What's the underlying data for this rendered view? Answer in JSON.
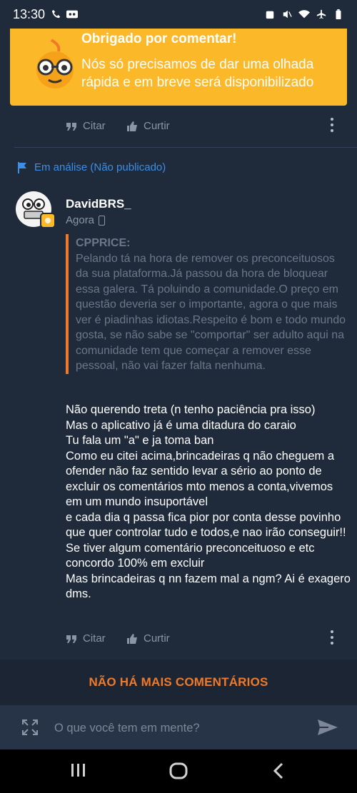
{
  "status_bar": {
    "time": "13:30"
  },
  "toast": {
    "title": "Obrigado por comentar!",
    "message": "Nós só precisamos de dar uma olhada rápida e em breve será disponibilizado"
  },
  "actions": {
    "quote_label": "Citar",
    "like_label": "Curtir"
  },
  "review_status": "Em análise (Não publicado)",
  "comment": {
    "username": "DavidBRS_",
    "time": "Agora",
    "quote_author": "CPPRICE:",
    "quote_text": "Pelando tá na hora de remover os preconceituosos da sua plataforma.Já passou da hora de bloquear essa galera. Tá poluindo a comunidade.O preço em questão deveria ser o importante, agora o que mais ver é piadinhas idiotas.Respeito é bom e todo mundo gosta, se não sabe se \"comportar\" ser adulto aqui na comunidade tem que começar a remover esse pessoal, não vai fazer falta nenhuma.",
    "body": "Não querendo treta (n tenho paciência pra isso)\nMas o aplicativo já é uma ditadura do caraio\nTu fala um \"a\" e ja toma ban\nComo eu citei acima,brincadeiras q não cheguem a ofender não faz sentido levar a sério ao ponto de excluir os comentários mto menos a conta,vivemos em um mundo insuportável\ne cada dia q passa fica pior por conta desse povinho que quer controlar tudo e todos,e nao irão conseguir!!\nSe tiver algum comentário preconceituoso e etc concordo 100% em excluir\nMas brincadeiras q nn fazem mal a ngm? Ai é exagero dms."
  },
  "no_more_comments": "NÃO HÁ MAIS COMENTÁRIOS",
  "input": {
    "placeholder": "O que você tem em mente?"
  },
  "colors": {
    "background": "#1f2a3a",
    "toast": "#fbb829",
    "accent_orange": "#f07a2a",
    "link_blue": "#3d8ee6"
  }
}
